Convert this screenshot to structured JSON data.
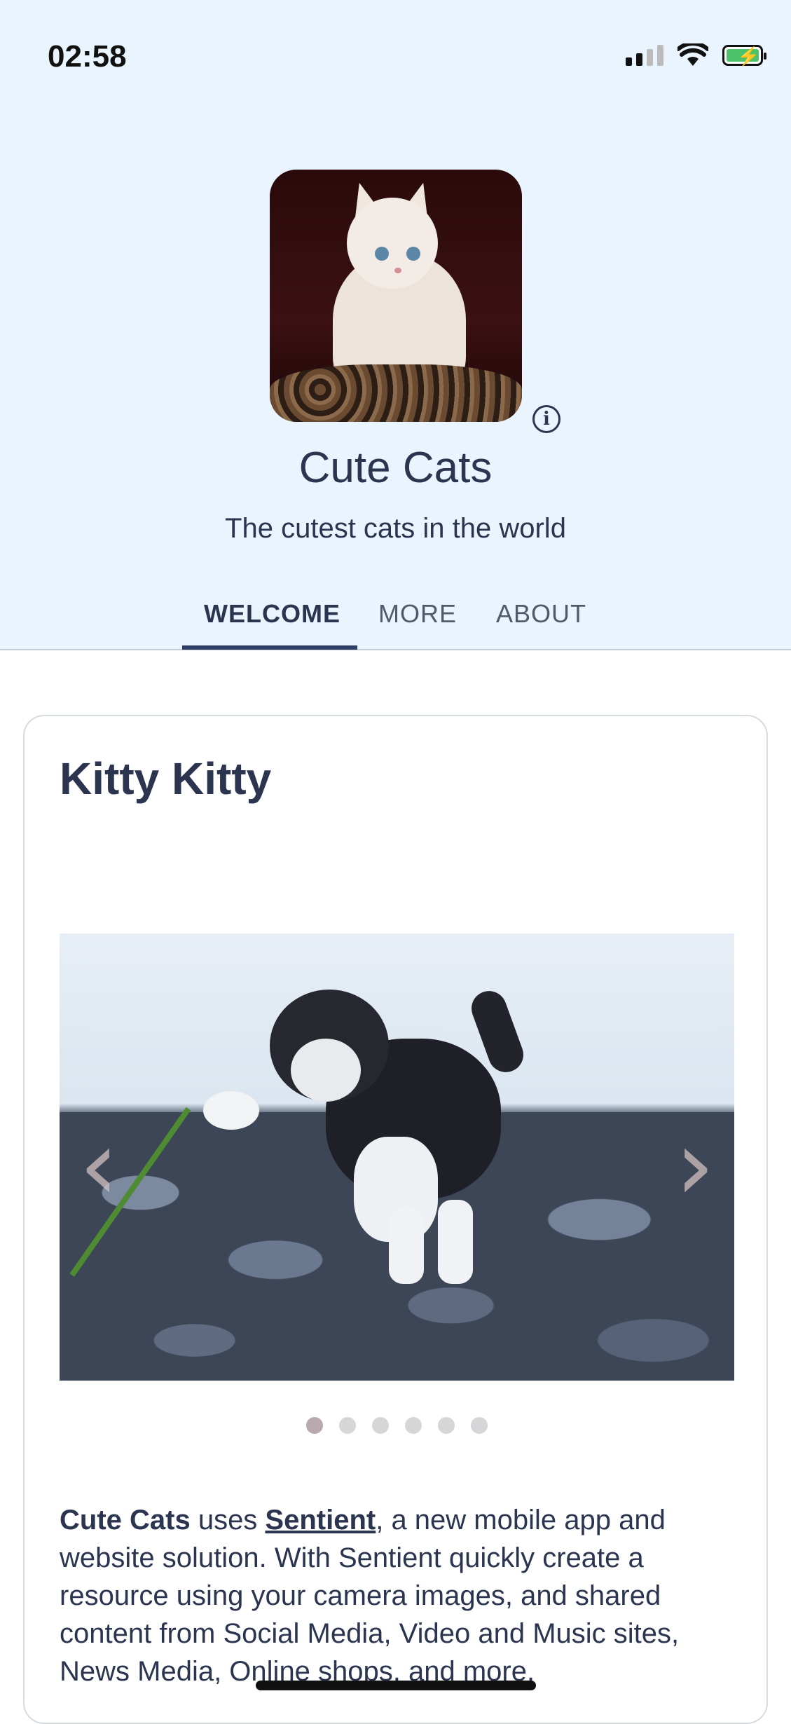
{
  "status_bar": {
    "time": "02:58"
  },
  "profile": {
    "title": "Cute Cats",
    "subtitle": "The cutest cats in the world",
    "info_icon": "i"
  },
  "tabs": [
    {
      "label": "WELCOME",
      "active": true
    },
    {
      "label": "MORE",
      "active": false
    },
    {
      "label": "ABOUT",
      "active": false
    }
  ],
  "card": {
    "title": "Kitty Kitty",
    "carousel": {
      "slide_count": 6,
      "active_index": 0,
      "prev_icon": "‹",
      "next_icon": "›"
    },
    "description": {
      "brand": "Cute Cats",
      "pre_link": " uses ",
      "link": "Sentient",
      "post_link": ", a new mobile app and website solution. With Sentient quickly create a resource using your camera images, and shared content from Social Media, Video and Music sites, News Media, Online shops, and more."
    }
  },
  "colors": {
    "header_bg": "#e9f4ff",
    "accent": "#2f3e66",
    "text": "#2b3550"
  }
}
